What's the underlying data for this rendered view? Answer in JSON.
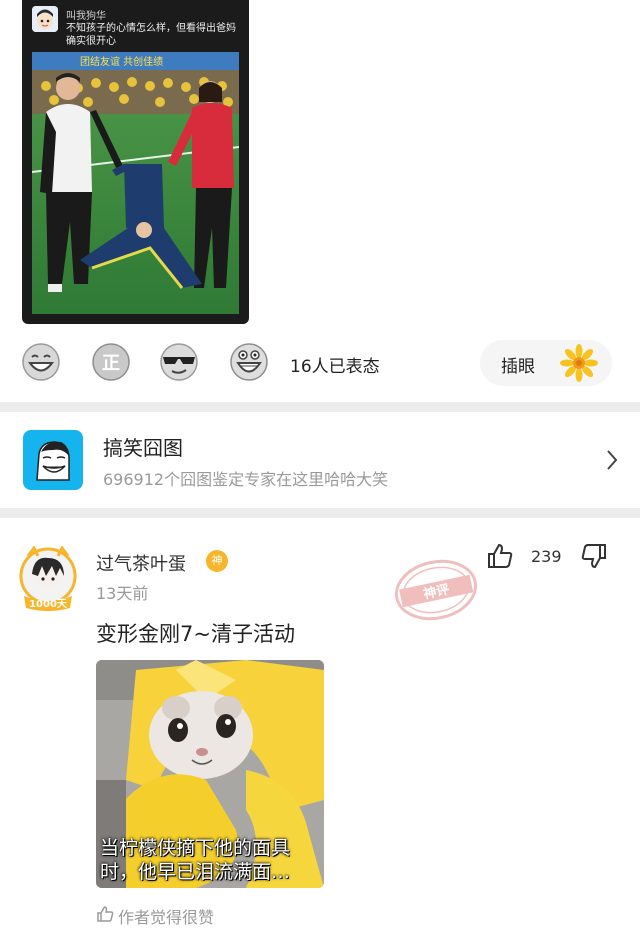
{
  "post": {
    "image": {
      "poster_name": "叫我狗华",
      "caption": "不知孩子的心情怎么样，但看得出爸妈确实很开心",
      "banner_text": "团结友谊 共创佳绩"
    },
    "reactions": {
      "icons": [
        "grin-icon",
        "zheng-icon",
        "sunglasses-icon",
        "laughing-icon"
      ],
      "count_label": "16人已表态"
    },
    "stick_button": {
      "label": "插眼",
      "icon": "flower-icon",
      "color": "#f8c320"
    }
  },
  "group": {
    "name": "搞笑囧图",
    "description": "696912个囧图鉴定专家在这里哈哈大笑",
    "logo_color": "#15b4ee"
  },
  "comment": {
    "user": "过气茶叶蛋",
    "badge": "神",
    "avatar_label": "1000天",
    "time": "13天前",
    "stamp_text": "神评",
    "like_count": "239",
    "text": "变形金刚7~清子活动",
    "image_caption": "当柠檬侠摘下他的面具时，他早已泪流满面…",
    "author_liked": "作者觉得很赞"
  },
  "colors": {
    "accent": "#f7b52c",
    "divider": "#ededed",
    "muted_text": "#9a9a9a"
  }
}
